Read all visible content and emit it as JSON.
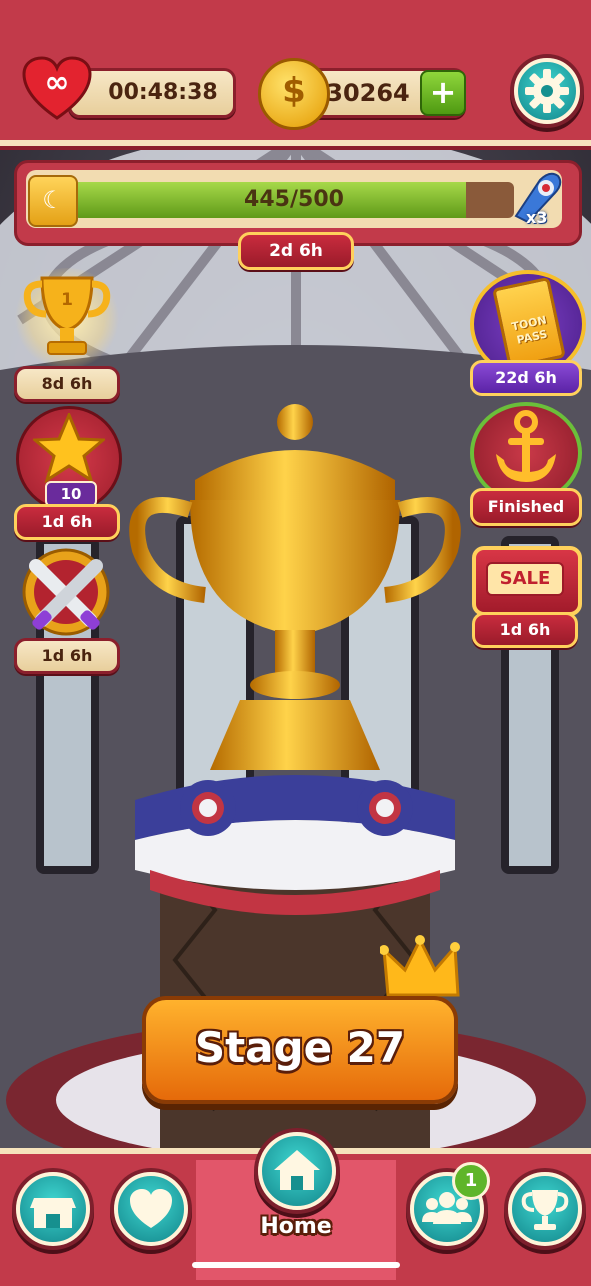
{
  "top_bar": {
    "lives_timer": "00:48:38",
    "coins": "30264"
  },
  "progress": {
    "value_label": "445/500",
    "value": 445,
    "max": 500,
    "timer": "2d 6h",
    "booster_count": "x3"
  },
  "left_events": [
    {
      "badge": "1",
      "timer": "8d 6h"
    },
    {
      "badge": "10",
      "timer": "1d 6h"
    },
    {
      "timer": "1d 6h"
    }
  ],
  "right_events": [
    {
      "badge_line1": "TOON",
      "badge_line2": "PASS",
      "timer": "22d 6h"
    },
    {
      "status": "Finished"
    },
    {
      "badge": "SALE",
      "timer": "1d 6h"
    }
  ],
  "stage_button": "Stage 27",
  "bottom_nav": {
    "home_label": "Home",
    "friends_badge": "1"
  },
  "colors": {
    "frame_red": "#c23a4a",
    "cream": "#f6e3bd",
    "teal": "#21a9a8",
    "green": "#7ab52e",
    "gold": "#f2b21c"
  }
}
